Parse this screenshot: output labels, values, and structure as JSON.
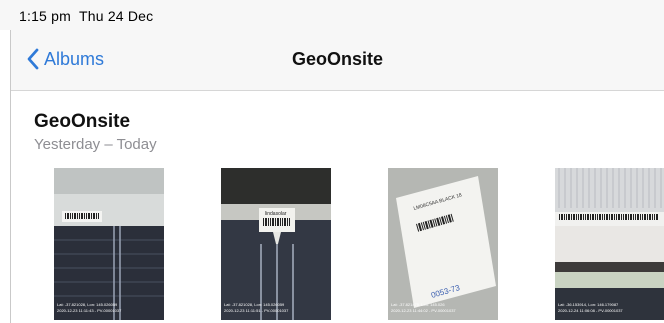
{
  "status_bar": {
    "time": "1:15 pm",
    "date": "Thu 24 Dec"
  },
  "nav": {
    "back_label": "Albums",
    "back_icon": "chevron-left-icon",
    "title": "GeoOnsite"
  },
  "section": {
    "title": "GeoOnsite",
    "subtitle": "Yesterday – Today"
  },
  "colors": {
    "accent": "#2f7ad8",
    "subtitle": "#8e8e93",
    "bar_background": "#f7f7f7"
  },
  "photos": [
    {
      "caption_line1": "Lat: -37.821028, Lon: 145.026059",
      "caption_line2": "2020-12-23 11:11:43 - PV-00001037"
    },
    {
      "label_text": "lindasolar",
      "caption_line1": "Lat: -37.821028, Lon: 145.026059",
      "caption_line2": "2020-12-23 11:11:51 - PV-00001037"
    },
    {
      "label_text": "LM08C5AA BLACK 18",
      "ink_text": "0053-73",
      "caption_line1": "Lat: -37.821475, Lon: 145.026",
      "caption_line2": "2020-12-23 11:44:02 - PV-00001037"
    },
    {
      "caption_line1": "Lat: -36.153914, Lon: 146.179087",
      "caption_line2": "2020-12-24 11:06:08 - PV-00001037"
    }
  ]
}
